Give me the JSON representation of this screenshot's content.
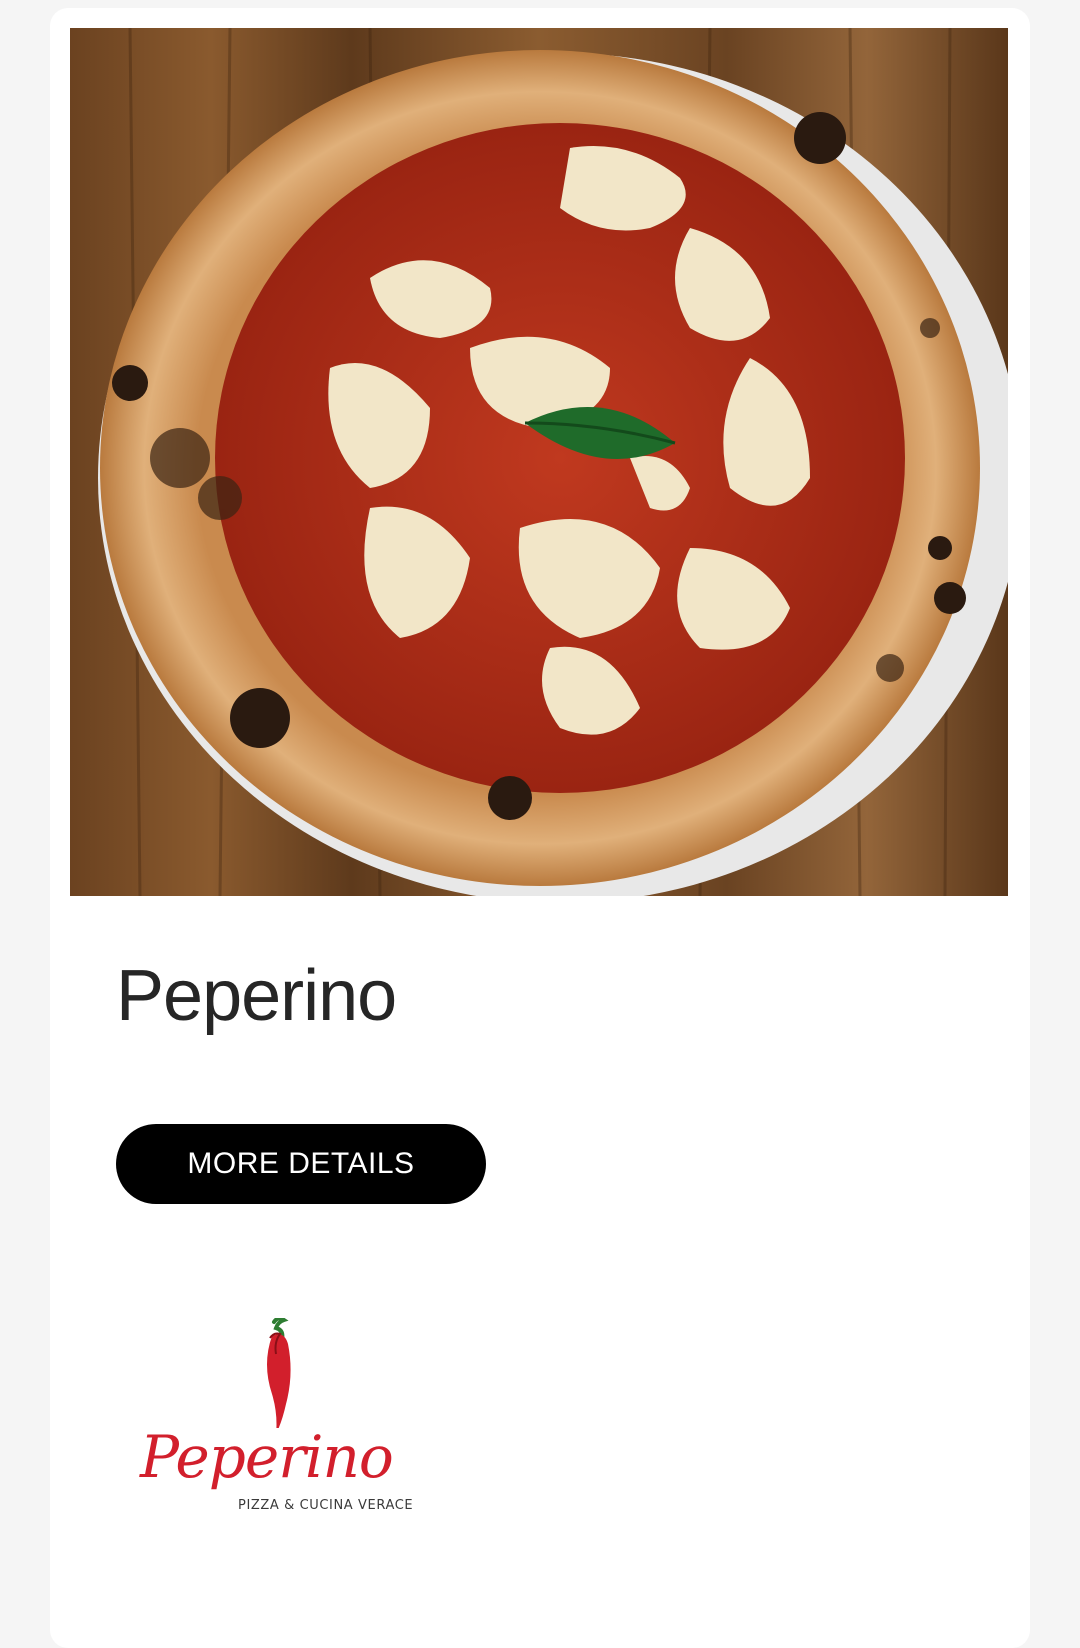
{
  "restaurant": {
    "name": "Peperino",
    "details_button_label": "MORE DETAILS"
  },
  "logo": {
    "script_text": "Peperino",
    "tagline": "PIZZA & CUCINA VERACE"
  },
  "image": {
    "subject": "margherita pizza on wooden table",
    "icon": "pizza-photo"
  },
  "colors": {
    "button_bg": "#000000",
    "button_text": "#ffffff",
    "logo_red": "#d21f2c",
    "logo_green": "#2e7d32",
    "title_text": "#262626"
  }
}
